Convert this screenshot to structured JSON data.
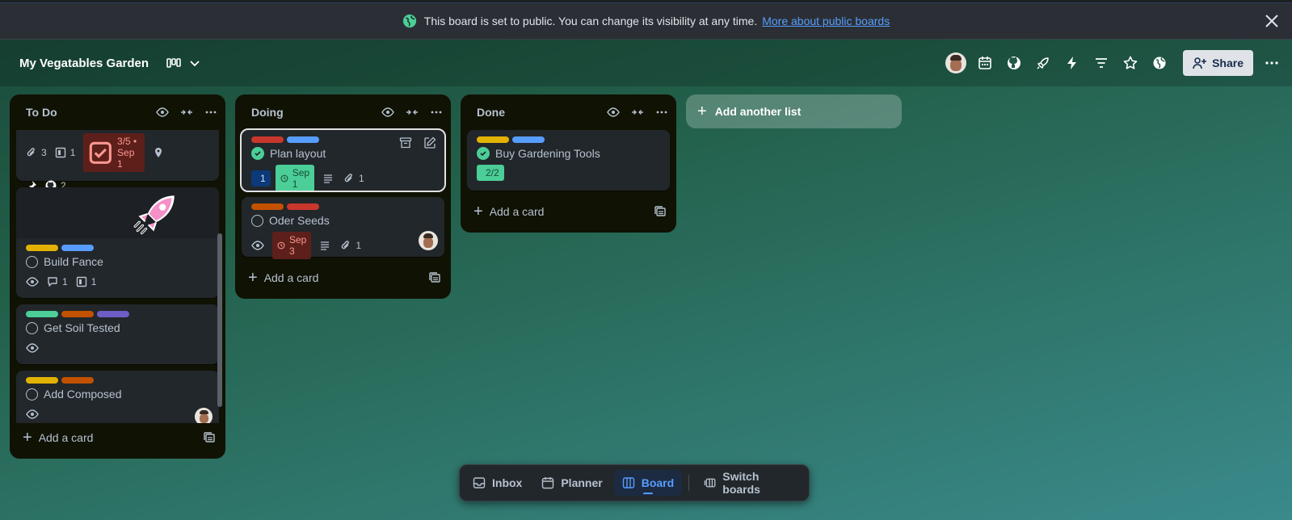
{
  "banner": {
    "text": "This board is set to public. You can change its visibility at any time.",
    "link": "More about public boards"
  },
  "header": {
    "board_title": "My Vegatables Garden",
    "share_label": "Share"
  },
  "lists": [
    {
      "title": "To Do",
      "add_card": "Add a card",
      "partial_card": {
        "attachments": "3",
        "checklist_cards": "1",
        "checklist": "3/5 • Sep 1",
        "github": "2"
      },
      "cards": [
        {
          "title": "Build Fance",
          "comments": "1",
          "cards": "1"
        },
        {
          "title": "Get Soil Tested"
        },
        {
          "title": "Add Composed"
        }
      ]
    },
    {
      "title": "Doing",
      "add_card": "Add a card",
      "cards": [
        {
          "title": "Plan layout",
          "likes": "1",
          "due": "Sep 1",
          "attachments": "1"
        },
        {
          "title": "Oder Seeds",
          "due": "Sep 3",
          "attachments": "1"
        }
      ]
    },
    {
      "title": "Done",
      "add_card": "Add a card",
      "cards": [
        {
          "title": "Buy Gardening Tools",
          "checklist": "2/2"
        }
      ]
    }
  ],
  "add_list": "Add another list",
  "nav": {
    "inbox": "Inbox",
    "planner": "Planner",
    "board": "Board",
    "switch": "Switch boards"
  },
  "colors": {
    "label_red": "#c9372c",
    "label_blue": "#579dff",
    "label_yellow": "#e2b203",
    "label_orange": "#c25100",
    "label_green": "#4bce97",
    "label_purple": "#6e5dc6",
    "due_green": "#4bce97",
    "due_red": "#5d1f1a",
    "like_blue": "#0c3a78"
  }
}
